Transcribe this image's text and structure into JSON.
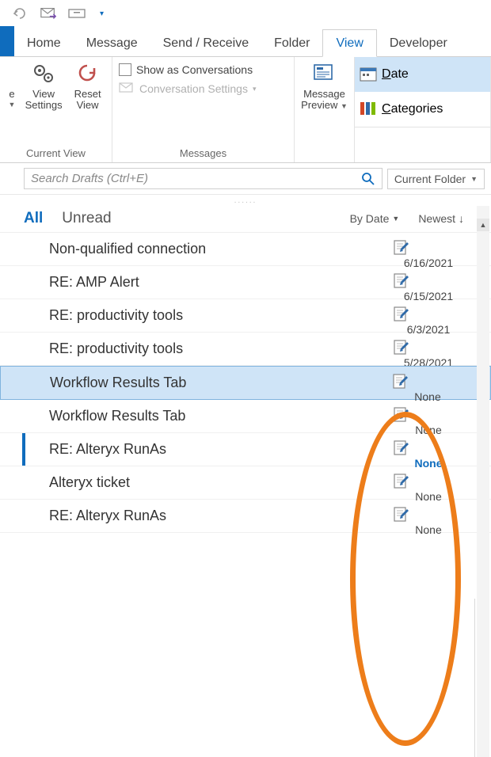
{
  "qat": {
    "dropdown_caret": "▾"
  },
  "tabs": {
    "home": "Home",
    "message": "Message",
    "send_receive": "Send / Receive",
    "folder": "Folder",
    "view": "View",
    "developer": "Developer"
  },
  "ribbon": {
    "current_view": {
      "e": "e",
      "view_settings_l1": "View",
      "view_settings_l2": "Settings",
      "reset_l1": "Reset",
      "reset_l2": "View",
      "group_label": "Current View"
    },
    "messages": {
      "show_as_conversations": "Show as Conversations",
      "conversation_settings": "Conversation Settings",
      "group_label": "Messages"
    },
    "message_preview": {
      "l1": "Message",
      "l2": "Preview"
    },
    "arrangement": {
      "date_prefix": "D",
      "date_rest": "ate",
      "categories_prefix": "C",
      "categories_rest": "ategories"
    }
  },
  "search": {
    "placeholder": "Search Drafts (Ctrl+E)",
    "scope": "Current Folder"
  },
  "filters": {
    "all": "All",
    "unread": "Unread",
    "by_date": "By Date",
    "newest": "Newest"
  },
  "messages": [
    {
      "subject": "Non-qualified connection",
      "date": "6/16/2021",
      "selected": false,
      "unread": false,
      "bold": false
    },
    {
      "subject": "RE: AMP Alert",
      "date": "6/15/2021",
      "selected": false,
      "unread": false,
      "bold": false
    },
    {
      "subject": "RE: productivity tools",
      "date": "6/3/2021",
      "selected": false,
      "unread": false,
      "bold": false
    },
    {
      "subject": "RE: productivity tools",
      "date": "5/28/2021",
      "selected": false,
      "unread": false,
      "bold": false
    },
    {
      "subject": "Workflow Results Tab",
      "date": "None",
      "selected": true,
      "unread": false,
      "bold": false
    },
    {
      "subject": "Workflow Results Tab",
      "date": "None",
      "selected": false,
      "unread": false,
      "bold": false
    },
    {
      "subject": "RE: Alteryx RunAs",
      "date": "None",
      "selected": false,
      "unread": true,
      "bold": true
    },
    {
      "subject": "Alteryx ticket",
      "date": "None",
      "selected": false,
      "unread": false,
      "bold": false
    },
    {
      "subject": "RE: Alteryx RunAs",
      "date": "None",
      "selected": false,
      "unread": false,
      "bold": false
    }
  ]
}
